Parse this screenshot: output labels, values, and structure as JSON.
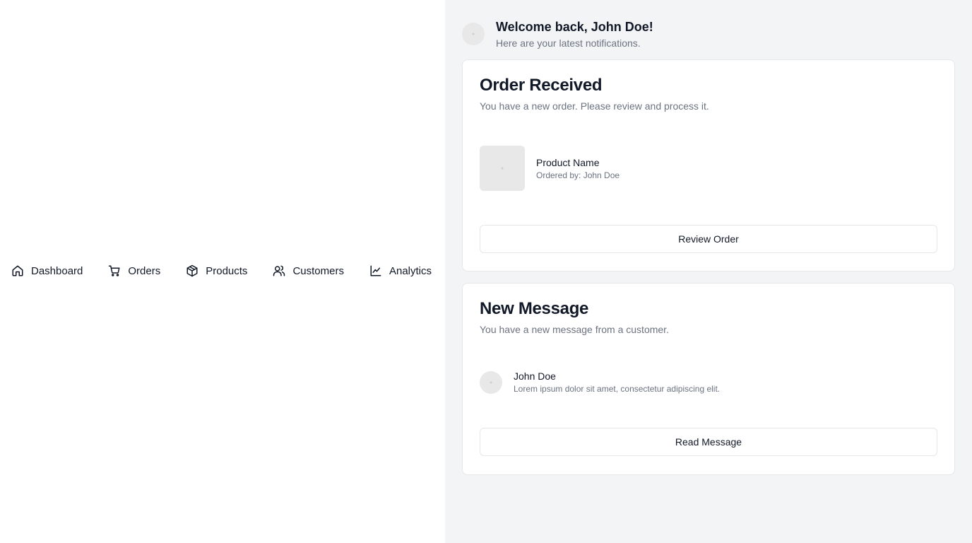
{
  "nav": {
    "items": [
      {
        "label": "Dashboard",
        "icon": "home-icon"
      },
      {
        "label": "Orders",
        "icon": "cart-icon"
      },
      {
        "label": "Products",
        "icon": "package-icon"
      },
      {
        "label": "Customers",
        "icon": "users-icon"
      },
      {
        "label": "Analytics",
        "icon": "line-chart-icon"
      }
    ]
  },
  "welcome": {
    "title": "Welcome back, John Doe!",
    "subtitle": "Here are your latest notifications."
  },
  "order_card": {
    "title": "Order Received",
    "subtitle": "You have a new order. Please review and process it.",
    "product_name": "Product Name",
    "ordered_by": "Ordered by: John Doe",
    "button": "Review Order"
  },
  "message_card": {
    "title": "New Message",
    "subtitle": "You have a new message from a customer.",
    "sender": "John Doe",
    "preview": "Lorem ipsum dolor sit amet, consectetur adipiscing elit.",
    "button": "Read Message"
  },
  "colors": {
    "panel_bg": "#f3f4f6",
    "card_border": "#e5e7eb",
    "muted_text": "#6b7280",
    "placeholder": "#e8e8e8"
  }
}
